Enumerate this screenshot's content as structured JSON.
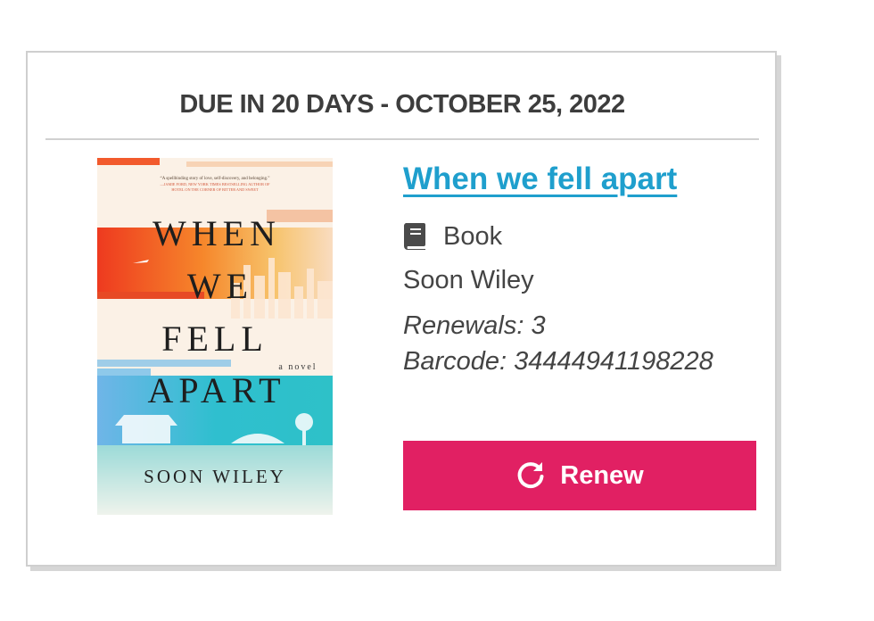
{
  "loan": {
    "due_label": "DUE IN 20 DAYS - OCTOBER 25, 2022",
    "title": "When we fell apart",
    "format": {
      "icon": "book-icon",
      "label": "Book"
    },
    "author": "Soon Wiley",
    "renewals": "Renewals: 3",
    "barcode": "Barcode: 34444941198228",
    "renew_button": {
      "icon": "refresh-icon",
      "label": "Renew"
    }
  },
  "cover": {
    "blurb_line1": "“A spellbinding story of love, self-discovery, and belonging.”",
    "blurb_line2": "—JAMIE FORD, NEW YORK TIMES BESTSELLING AUTHOR OF",
    "blurb_line3": "HOTEL ON THE CORNER OF BITTER AND SWEET",
    "title_line1": "WHEN",
    "title_line2": "WE",
    "title_line3": "FELL",
    "title_line4": "APART",
    "subtitle": "a novel",
    "author": "SOON WILEY"
  },
  "colors": {
    "link": "#1f9fcd",
    "button": "#e12063",
    "text": "#444444"
  }
}
